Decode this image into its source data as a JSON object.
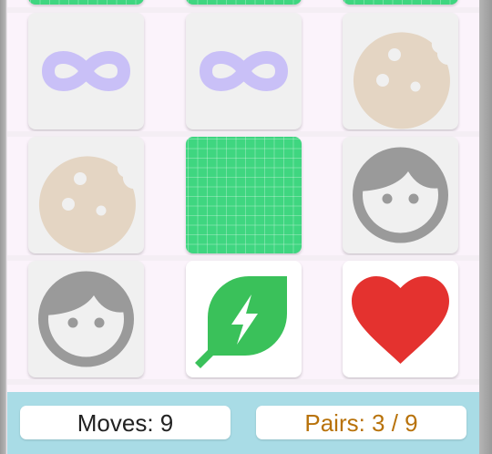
{
  "footer": {
    "moves_text": "Moves: 9",
    "pairs_text": "Pairs: 3 / 9",
    "moves": 9,
    "pairs_found": 3,
    "pairs_total": 9
  },
  "colors": {
    "card_back": "#3fd680",
    "card_face": "#f0f0f0",
    "card_matched": "#ffffff",
    "board_bg": "#fbf3fb",
    "footer_bg": "#a9dce6",
    "pairs_text": "#b8720a",
    "infinity": "#c9c0f7",
    "cookie": "#e4d5c3",
    "face": "#9a9a9a",
    "leaf": "#3ac15a",
    "heart": "#e4322f"
  },
  "cards": [
    {
      "state": "face-down"
    },
    {
      "state": "face-down"
    },
    {
      "state": "face-down"
    },
    {
      "state": "face-up",
      "icon": "infinity-icon"
    },
    {
      "state": "face-up",
      "icon": "infinity-icon"
    },
    {
      "state": "face-up",
      "icon": "cookie-icon"
    },
    {
      "state": "face-up",
      "icon": "cookie-icon"
    },
    {
      "state": "face-down"
    },
    {
      "state": "face-up",
      "icon": "face-icon"
    },
    {
      "state": "face-up",
      "icon": "face-icon"
    },
    {
      "state": "matched",
      "icon": "eco-leaf-icon"
    },
    {
      "state": "matched",
      "icon": "heart-icon"
    }
  ]
}
